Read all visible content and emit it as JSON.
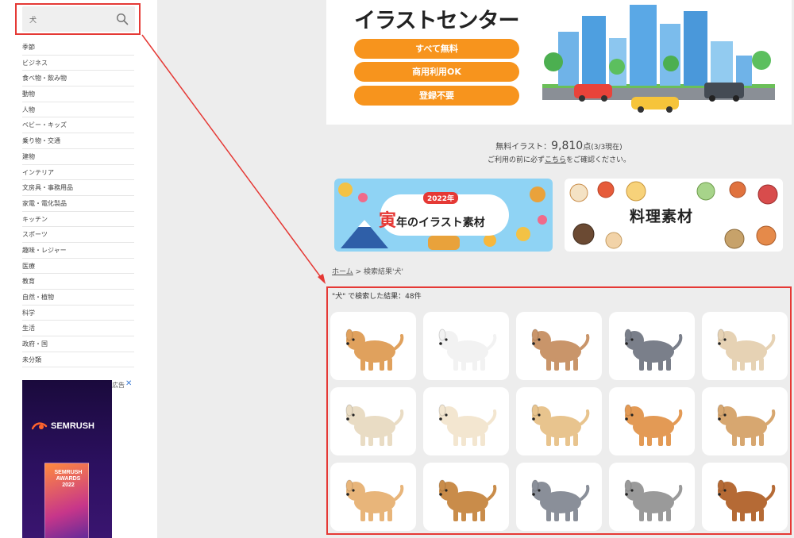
{
  "search": {
    "value": "犬",
    "icon": "search-icon"
  },
  "sidebar": {
    "categories": [
      "季節",
      "ビジネス",
      "食べ物・飲み物",
      "動物",
      "人物",
      "ベビー・キッズ",
      "乗り物・交通",
      "建物",
      "インテリア",
      "文房具・事務用品",
      "家電・電化製品",
      "キッチン",
      "スポーツ",
      "趣味・レジャー",
      "医療",
      "教育",
      "自然・植物",
      "科学",
      "生活",
      "政府・国",
      "未分類"
    ],
    "ad": {
      "label": "広告",
      "close": "✕",
      "brand": "SEMRUSH",
      "trophy_lines": [
        "SEMRUSH",
        "AWARDS",
        "2022"
      ]
    }
  },
  "hero": {
    "title": "イラストセンター",
    "pills": [
      "すべて無料",
      "商用利用OK",
      "登録不要"
    ]
  },
  "stats": {
    "prefix": "無料イラスト：",
    "count": "9,810",
    "unit": "点",
    "date": "(3/3現在)",
    "notice_before": "ご利用の前に必ず",
    "notice_link": "こちら",
    "notice_after": "をご確認ください。"
  },
  "promos": {
    "left": {
      "year_badge": "2022年",
      "big_char": "寅",
      "text": "年のイラスト素材"
    },
    "right": {
      "text": "料理素材"
    }
  },
  "breadcrumb": {
    "home": "ホーム",
    "separator": " > ",
    "current": "検索結果'犬'"
  },
  "results": {
    "summary": "\"犬\" で検索した結果：48件",
    "items": [
      {
        "name": "corgi",
        "fur": "#e0a15d"
      },
      {
        "name": "maltese",
        "fur": "#f2f2f2"
      },
      {
        "name": "pekingese",
        "fur": "#c9956a"
      },
      {
        "name": "husky",
        "fur": "#7a7f8a"
      },
      {
        "name": "shih-tzu",
        "fur": "#e6d2b4"
      },
      {
        "name": "pug",
        "fur": "#e9dcc4"
      },
      {
        "name": "chihuahua",
        "fur": "#f3e6d0"
      },
      {
        "name": "shiba",
        "fur": "#e8c48e"
      },
      {
        "name": "shiba-mask",
        "fur": "#e39a55"
      },
      {
        "name": "puppies",
        "fur": "#d7a770"
      },
      {
        "name": "akita-plush",
        "fur": "#e8b57a"
      },
      {
        "name": "mastiff",
        "fur": "#c98c4a"
      },
      {
        "name": "greyhound",
        "fur": "#8a8f99"
      },
      {
        "name": "yorkshire",
        "fur": "#9a9a9a"
      },
      {
        "name": "st-bernard",
        "fur": "#b56a35"
      }
    ]
  },
  "colors": {
    "accent_orange": "#f7941d",
    "annotation_red": "#e53935"
  }
}
